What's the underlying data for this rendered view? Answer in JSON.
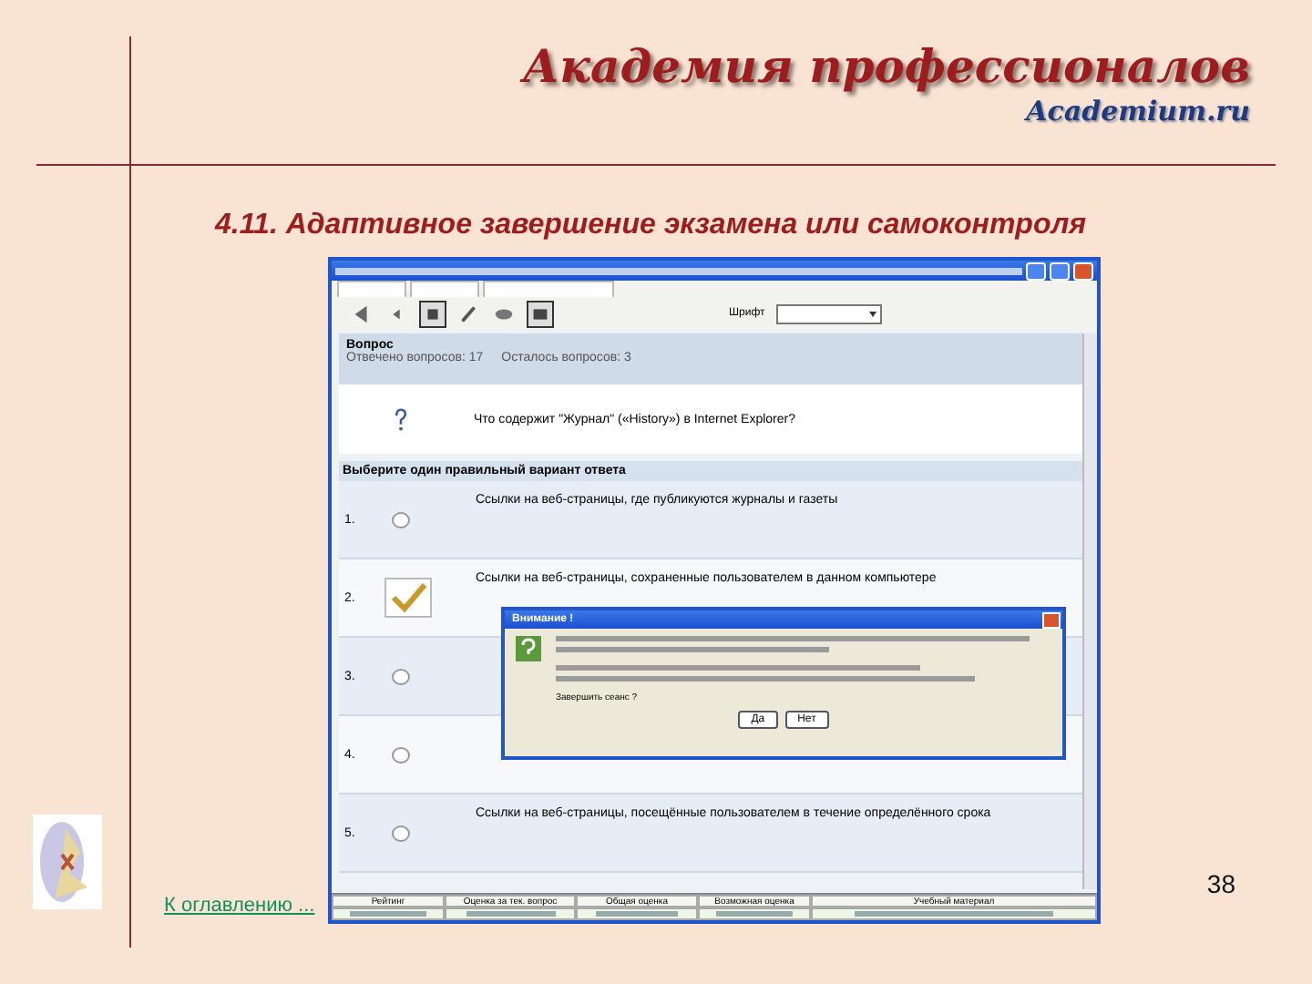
{
  "slide": {
    "brand": "Академия профессионалов",
    "domain": "Academium.ru",
    "heading": "4.11. Адаптивное завершение экзамена или самоконтроля",
    "link": "К оглавлению ...",
    "page_number": "38"
  },
  "window": {
    "toolbar": {
      "font_label": "Шрифт"
    },
    "question_panel": {
      "title": "Вопрос",
      "answered": "Отвечено вопросов: 17",
      "remaining": "Осталось вопросов: 3"
    },
    "question": "Что содержит \"Журнал\" («History») в Internet Explorer?",
    "instruction": "Выберите один правильный вариант ответа",
    "options": [
      {
        "number": "1.",
        "text": "Ссылки на веб-страницы, где публикуются журналы и газеты",
        "selected": false
      },
      {
        "number": "2.",
        "text": "Ссылки на веб-страницы, сохраненные пользователем в данном компьютере",
        "selected": true
      },
      {
        "number": "3.",
        "selected": false
      },
      {
        "number": "4.",
        "selected": false
      },
      {
        "number": "5.",
        "text": "Ссылки на веб-страницы, посещённые пользователем в течение определённого срока",
        "selected": false
      }
    ],
    "status_table": {
      "columns": [
        "Рейтинг",
        "Оценка за тек. вопрос",
        "Общая оценка",
        "Возможная оценка",
        "Учебный материал"
      ]
    },
    "dialog": {
      "title": "Внимание !",
      "prompt": "Завершить сеанс ?",
      "buttons": [
        "Да",
        "Нет"
      ]
    }
  }
}
